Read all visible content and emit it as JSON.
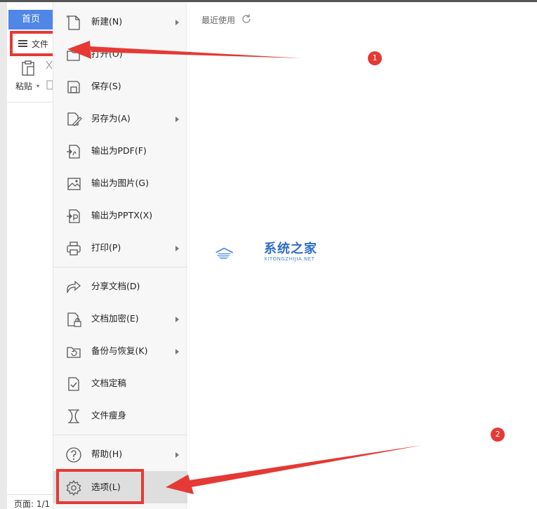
{
  "ribbon": {
    "home_tab": "首页",
    "file_button": "文件",
    "paste_label": "粘贴"
  },
  "status": {
    "page": "页面: 1/1"
  },
  "file_menu": {
    "items": [
      {
        "label": "新建(N)",
        "icon": "new-doc-icon",
        "submenu": true
      },
      {
        "label": "打开(O)",
        "icon": "open-folder-icon",
        "submenu": false
      },
      {
        "label": "保存(S)",
        "icon": "save-icon",
        "submenu": false
      },
      {
        "label": "另存为(A)",
        "icon": "save-as-icon",
        "submenu": true
      },
      {
        "label": "输出为PDF(F)",
        "icon": "export-pdf-icon",
        "submenu": false
      },
      {
        "label": "输出为图片(G)",
        "icon": "export-image-icon",
        "submenu": false
      },
      {
        "label": "输出为PPTX(X)",
        "icon": "export-pptx-icon",
        "submenu": false
      },
      {
        "label": "打印(P)",
        "icon": "print-icon",
        "submenu": true
      },
      {
        "label": "分享文档(D)",
        "icon": "share-icon",
        "submenu": false
      },
      {
        "label": "文档加密(E)",
        "icon": "encrypt-icon",
        "submenu": true
      },
      {
        "label": "备份与恢复(K)",
        "icon": "backup-icon",
        "submenu": true
      },
      {
        "label": "文档定稿",
        "icon": "finalize-icon",
        "submenu": false
      },
      {
        "label": "文件瘦身",
        "icon": "slim-icon",
        "submenu": false
      },
      {
        "label": "帮助(H)",
        "icon": "help-icon",
        "submenu": true
      },
      {
        "label": "选项(L)",
        "icon": "gear-icon",
        "submenu": false,
        "selected": true
      }
    ]
  },
  "recent": {
    "label": "最近使用"
  },
  "watermark": {
    "title": "系统之家",
    "subtitle": "XITONGZHIJIA.NET"
  },
  "callouts": {
    "first": "1",
    "second": "2",
    "color": "#e53935"
  }
}
